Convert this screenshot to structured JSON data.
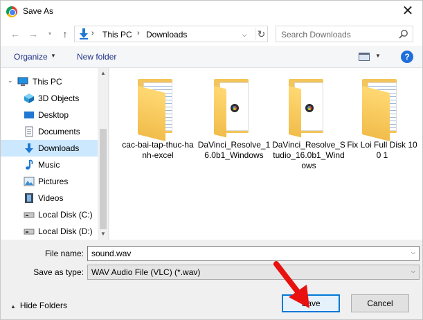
{
  "window": {
    "title": "Save As"
  },
  "address": {
    "crumbs": [
      "This PC",
      "Downloads"
    ]
  },
  "search": {
    "placeholder": "Search Downloads"
  },
  "toolbar": {
    "organize": "Organize",
    "new_folder": "New folder"
  },
  "nav": {
    "items": [
      {
        "label": "This PC",
        "icon": "monitor-icon",
        "top": true
      },
      {
        "label": "3D Objects",
        "icon": "cube-icon"
      },
      {
        "label": "Desktop",
        "icon": "desktop-icon"
      },
      {
        "label": "Documents",
        "icon": "document-icon"
      },
      {
        "label": "Downloads",
        "icon": "download-arrow-icon",
        "selected": true
      },
      {
        "label": "Music",
        "icon": "music-note-icon"
      },
      {
        "label": "Pictures",
        "icon": "picture-icon"
      },
      {
        "label": "Videos",
        "icon": "film-icon"
      },
      {
        "label": "Local Disk (C:)",
        "icon": "drive-icon"
      },
      {
        "label": "Local Disk (D:)",
        "icon": "drive-icon"
      }
    ]
  },
  "files": [
    {
      "name": "cac-bai-tap-thuc-hanh-excel",
      "icon": "folder-with-documents-icon"
    },
    {
      "name": "DaVinci_Resolve_16.0b1_Windows",
      "icon": "folder-with-resolve-icon"
    },
    {
      "name": "DaVinci_Resolve_Studio_16.0b1_Windows",
      "icon": "folder-with-resolve-icon"
    },
    {
      "name": "Fix Loi Full Disk 100 1",
      "icon": "folder-with-documents-icon"
    }
  ],
  "form": {
    "file_name_label": "File name:",
    "file_name_value": "sound.wav",
    "save_type_label": "Save as type:",
    "save_type_value": "WAV Audio File (VLC) (*.wav)",
    "hide_folders": "Hide Folders",
    "save": "Save",
    "cancel": "Cancel"
  },
  "colors": {
    "accent": "#0078d7",
    "selection": "#cce8ff",
    "annotation": "#e8110f"
  }
}
